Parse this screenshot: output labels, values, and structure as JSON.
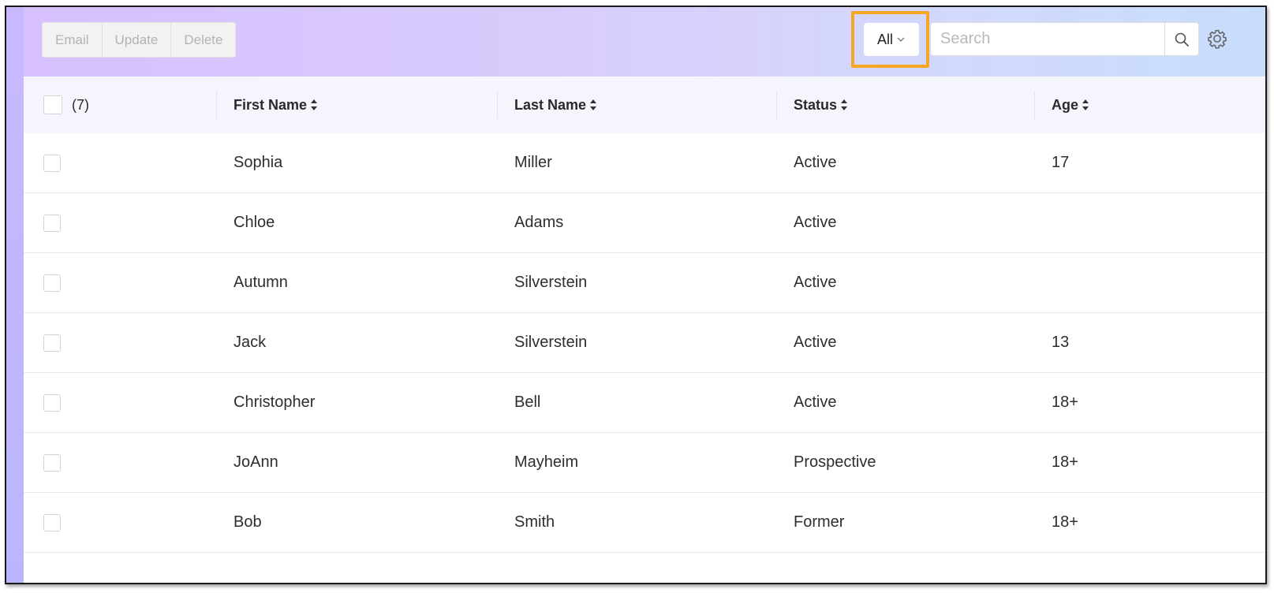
{
  "toolbar": {
    "email_label": "Email",
    "update_label": "Update",
    "delete_label": "Delete",
    "filter_label": "All",
    "search_placeholder": "Search",
    "search_value": ""
  },
  "colors": {
    "highlight": "#f5a623",
    "toolbar_gradient_start": "#d6c0ff",
    "toolbar_gradient_end": "#c8ddfc",
    "header_bg": "#f5f5fd"
  },
  "icons": {
    "filter": "chevron-down-icon",
    "search": "search-icon",
    "settings": "gear-icon",
    "sort": "sort-icon"
  },
  "table": {
    "selected_count": "(7)",
    "columns": [
      "First Name",
      "Last Name",
      "Status",
      "Age"
    ],
    "rows": [
      {
        "first": "Sophia",
        "last": "Miller",
        "status": "Active",
        "age": "17"
      },
      {
        "first": "Chloe",
        "last": "Adams",
        "status": "Active",
        "age": ""
      },
      {
        "first": "Autumn",
        "last": "Silverstein",
        "status": "Active",
        "age": ""
      },
      {
        "first": "Jack",
        "last": "Silverstein",
        "status": "Active",
        "age": "13"
      },
      {
        "first": "Christopher",
        "last": "Bell",
        "status": "Active",
        "age": "18+"
      },
      {
        "first": "JoAnn",
        "last": "Mayheim",
        "status": "Prospective",
        "age": "18+"
      },
      {
        "first": "Bob",
        "last": "Smith",
        "status": "Former",
        "age": "18+"
      }
    ]
  }
}
